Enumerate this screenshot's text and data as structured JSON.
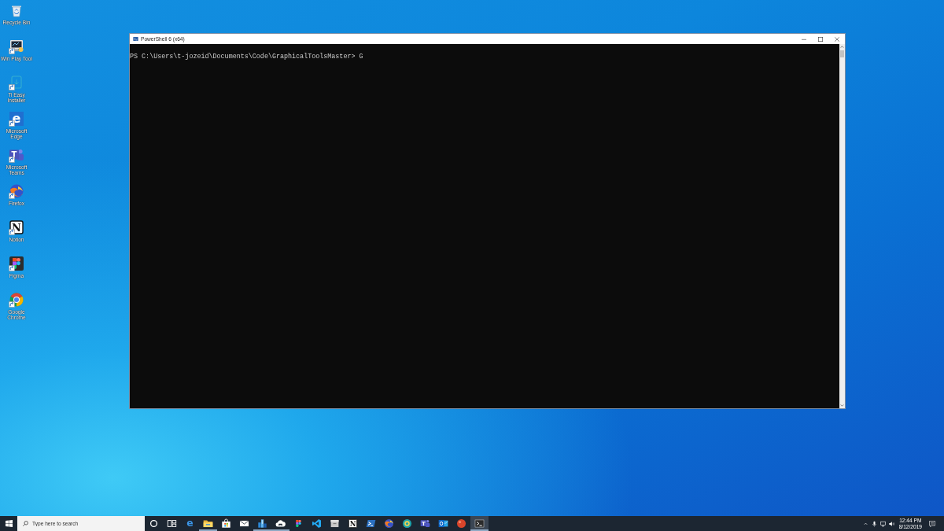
{
  "desktop": {
    "icons": [
      {
        "label": "Recycle Bin",
        "kind": "recycle-bin",
        "shortcut": false
      },
      {
        "label": "Win Play Tool",
        "kind": "monitor",
        "shortcut": true
      },
      {
        "label": "Ti Easy Installer",
        "kind": "installer",
        "shortcut": true
      },
      {
        "label": "Microsoft Edge",
        "kind": "edge",
        "glyph": "e",
        "shortcut": true
      },
      {
        "label": "Microsoft Teams",
        "kind": "teams",
        "glyph": "T",
        "shortcut": true
      },
      {
        "label": "Firefox",
        "kind": "firefox",
        "shortcut": true
      },
      {
        "label": "Notion",
        "kind": "notion",
        "glyph": "N",
        "shortcut": true
      },
      {
        "label": "Figma",
        "kind": "figma",
        "shortcut": true
      },
      {
        "label": "Google Chrome",
        "kind": "chrome",
        "shortcut": true
      }
    ]
  },
  "window": {
    "title": "PowerShell 6 (x64)",
    "console_lines": [
      "PS C:\\Users\\t-jozeid\\Documents\\Code\\GraphicalToolsMaster> G"
    ]
  },
  "taskbar": {
    "search": {
      "placeholder": "Type here to search"
    },
    "apps": [
      {
        "kind": "cortana",
        "running": false,
        "selected": false
      },
      {
        "kind": "task-view",
        "running": false,
        "selected": false
      },
      {
        "kind": "edge",
        "glyph": "e",
        "running": false,
        "selected": false
      },
      {
        "kind": "explorer",
        "running": true,
        "selected": false
      },
      {
        "kind": "store",
        "running": false,
        "selected": false
      },
      {
        "kind": "mail",
        "running": false,
        "selected": false
      },
      {
        "kind": "office",
        "running": true,
        "selected": false
      },
      {
        "kind": "cloud",
        "running": true,
        "selected": false
      },
      {
        "kind": "figma",
        "running": false,
        "selected": false
      },
      {
        "kind": "vscode",
        "running": false,
        "selected": false
      },
      {
        "kind": "archive",
        "running": false,
        "selected": false
      },
      {
        "kind": "notion",
        "glyph": "N",
        "running": false,
        "selected": false
      },
      {
        "kind": "powershell",
        "running": false,
        "selected": false
      },
      {
        "kind": "firefox",
        "running": false,
        "selected": false
      },
      {
        "kind": "sphere",
        "running": false,
        "selected": false
      },
      {
        "kind": "teams",
        "glyph": "T",
        "running": false,
        "selected": false
      },
      {
        "kind": "outlook",
        "running": false,
        "selected": false
      },
      {
        "kind": "red-ball",
        "running": false,
        "selected": false
      },
      {
        "kind": "terminal",
        "running": true,
        "selected": true
      }
    ],
    "tray": {
      "time": "12:44 PM",
      "date": "8/12/2019"
    }
  }
}
